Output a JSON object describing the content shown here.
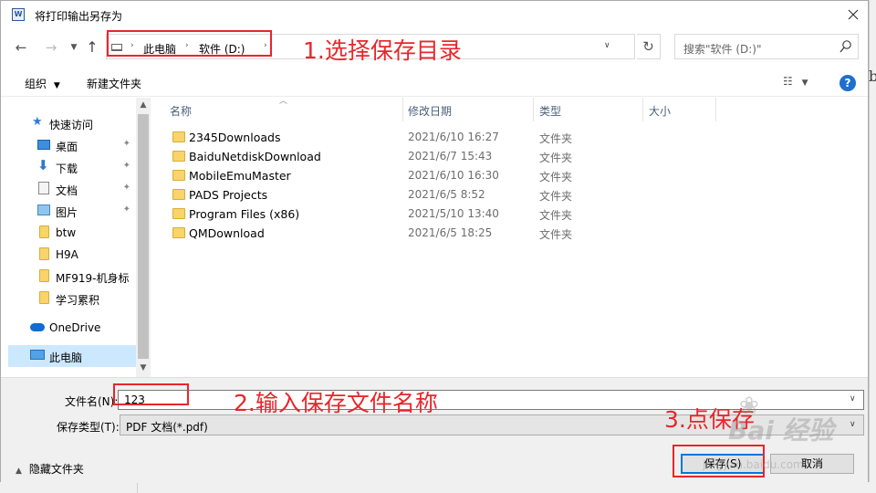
{
  "window": {
    "title": "将打印输出另存为",
    "app_icon": "W"
  },
  "nav": {
    "back_glyph": "←",
    "forward_glyph": "→",
    "up_glyph": "↑",
    "refresh_glyph": "↻",
    "breadcrumb": [
      "此电脑",
      "软件 (D:)"
    ],
    "search_placeholder": "搜索\"软件 (D:)\""
  },
  "toolbar": {
    "organize": "组织",
    "new_folder": "新建文件夹",
    "help": "?"
  },
  "sidebar": {
    "items": [
      {
        "label": "快速访问",
        "icon": "star-icon",
        "pinned": false
      },
      {
        "label": "桌面",
        "icon": "desktop-icon",
        "pinned": true
      },
      {
        "label": "下载",
        "icon": "download-icon",
        "pinned": true
      },
      {
        "label": "文档",
        "icon": "document-icon",
        "pinned": true
      },
      {
        "label": "图片",
        "icon": "pictures-icon",
        "pinned": true
      },
      {
        "label": "btw",
        "icon": "folder-icon",
        "pinned": false
      },
      {
        "label": "H9A",
        "icon": "folder-icon",
        "pinned": false
      },
      {
        "label": "MF919-机身标",
        "icon": "folder-icon",
        "pinned": false
      },
      {
        "label": "学习累积",
        "icon": "folder-icon",
        "pinned": false
      },
      {
        "label": "OneDrive",
        "icon": "cloud-icon",
        "pinned": false
      },
      {
        "label": "此电脑",
        "icon": "computer-icon",
        "pinned": false
      }
    ],
    "pin_glyph": "📌"
  },
  "file_list": {
    "columns": [
      "名称",
      "修改日期",
      "类型",
      "大小"
    ],
    "rows": [
      {
        "name": "2345Downloads",
        "date": "2021/6/10 16:27",
        "type": "文件夹"
      },
      {
        "name": "BaiduNetdiskDownload",
        "date": "2021/6/7 15:43",
        "type": "文件夹"
      },
      {
        "name": "MobileEmuMaster",
        "date": "2021/6/10 16:30",
        "type": "文件夹"
      },
      {
        "name": "PADS Projects",
        "date": "2021/6/5 8:52",
        "type": "文件夹"
      },
      {
        "name": "Program Files (x86)",
        "date": "2021/5/10 13:40",
        "type": "文件夹"
      },
      {
        "name": "QMDownload",
        "date": "2021/6/5 18:25",
        "type": "文件夹"
      }
    ]
  },
  "save_form": {
    "filename_label": "文件名(N):",
    "filename_value": "123",
    "filetype_label": "保存类型(T):",
    "filetype_value": "PDF 文档(*.pdf)",
    "hide_folders": "隐藏文件夹",
    "save_button": "保存(S)",
    "cancel_button": "取消"
  },
  "annotations": {
    "step1": "1.选择保存目录",
    "step2": "2.输入保存文件名称",
    "step3": "3.点保存",
    "color": "#e8262b"
  },
  "watermark": {
    "main": "Bai 经验",
    "sub": "jingyan.baidu.com"
  },
  "background": {
    "glyph": "b"
  }
}
